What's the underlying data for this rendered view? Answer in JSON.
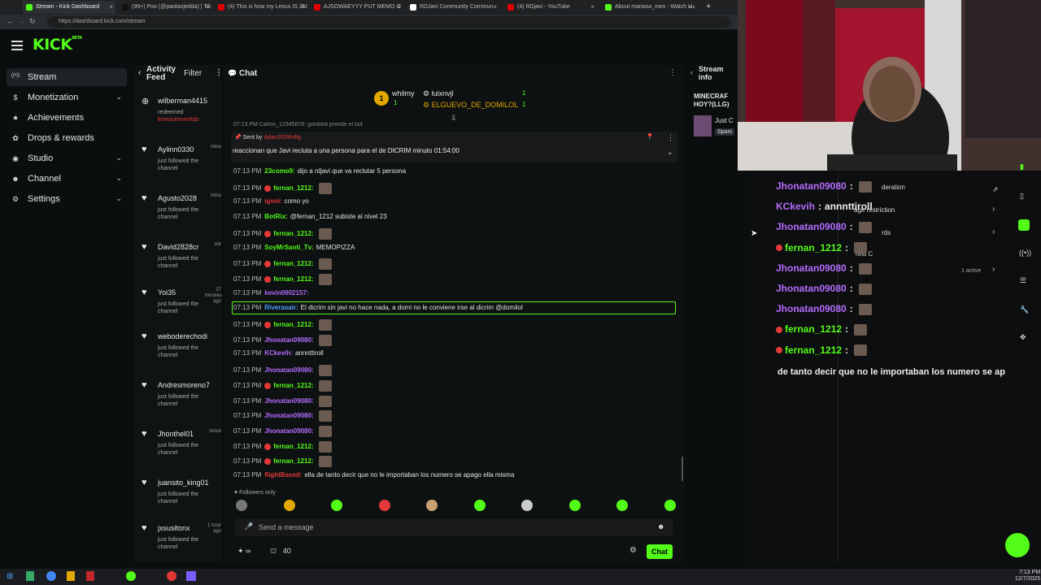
{
  "browser": {
    "tabs": [
      {
        "title": "Stream - Kick Dashboard",
        "color": "#53fc18",
        "active": true
      },
      {
        "title": "(99+) Poo (@paolaojedda) | TikTok",
        "color": "#111111",
        "active": false
      },
      {
        "title": "(4) This is how my Lexus IS 350 lo",
        "color": "#e00000",
        "active": false
      },
      {
        "title": "AJSOWAEYYY PUT MEMO O",
        "color": "#e00000",
        "active": false
      },
      {
        "title": "RDJavi Community Commun",
        "color": "#ffffff",
        "active": false
      },
      {
        "title": "(4) RDjavi - YouTube",
        "color": "#e00000",
        "active": false
      },
      {
        "title": "About mariasa_mex - Watch Live",
        "color": "#53fc18",
        "active": false
      }
    ],
    "url": "https://dashboard.kick.com/stream"
  },
  "brand": {
    "logo": "KICK",
    "logo_sup": "BETA",
    "accent": "#53fc18"
  },
  "sidebar": {
    "items": [
      {
        "label": "Stream",
        "icon": "broadcast-icon",
        "active": true,
        "expand": false
      },
      {
        "label": "Monetization",
        "icon": "dollar-icon",
        "active": false,
        "expand": true
      },
      {
        "label": "Achievements",
        "icon": "star-icon",
        "active": false,
        "expand": false
      },
      {
        "label": "Drops & rewards",
        "icon": "gift-icon",
        "active": false,
        "expand": false
      },
      {
        "label": "Studio",
        "icon": "studio-icon",
        "active": false,
        "expand": true
      },
      {
        "label": "Channel",
        "icon": "user-icon",
        "active": false,
        "expand": true
      },
      {
        "label": "Settings",
        "icon": "gear-icon",
        "active": false,
        "expand": true
      }
    ]
  },
  "feed": {
    "title_line1": "Activity",
    "title_line2": "Feed",
    "filter_label": "Filter",
    "items": [
      {
        "name": "wilberman4415",
        "ago": "",
        "action": "redeemed",
        "extra": "timeoutreverttdo",
        "icon": "redeem-icon"
      },
      {
        "name": "Aylinn0330",
        "ago": "minu",
        "action": "just followed the channel",
        "icon": "heart-icon"
      },
      {
        "name": "Agusto2028",
        "ago": "minu",
        "action": "just followed the channel",
        "icon": "heart-icon"
      },
      {
        "name": "David2828cr",
        "ago": "mir",
        "action": "just followed the channel",
        "icon": "heart-icon"
      },
      {
        "name": "Yoi35",
        "ago": "27 minutes ago",
        "action": "just followed the channel",
        "icon": "heart-icon"
      },
      {
        "name": "weboderechodi",
        "ago": "",
        "action": "just followed the channel",
        "icon": "heart-icon"
      },
      {
        "name": "Andresmoreno7",
        "ago": "",
        "action": "just followed the channel",
        "icon": "heart-icon"
      },
      {
        "name": "Jhonthel01",
        "ago": "minut",
        "action": "just followed the channel",
        "icon": "heart-icon"
      },
      {
        "name": "juansito_king01",
        "ago": "",
        "action": "just followed the channel",
        "icon": "heart-icon"
      },
      {
        "name": "jxsusitonx",
        "ago": "1 hour ago",
        "action": "just followed the channel",
        "icon": "heart-icon"
      }
    ]
  },
  "chat": {
    "title": "Chat",
    "leaders": [
      {
        "rank": "1",
        "name": "whilmy",
        "count": "1"
      },
      {
        "rank": "",
        "name": "luixnvjl",
        "count": "1"
      },
      {
        "rank": "",
        "name": "ELGUEVO_DE_DOMILOL",
        "count": "1"
      }
    ],
    "top_snippet": "07:13 PM  Carlos_12345678: gordolol prende el bot",
    "pinned_by_label": "Sent by",
    "pinned_by_user": "dylan2028hdtg",
    "pinned_text": "reaccionan que Javi reciuta a una persona para el de DICRIM minuto 01:54:00",
    "messages": [
      {
        "time": "07:13 PM",
        "user": "23como9:",
        "color": "#53fc18",
        "text": "dijo a rdjavi que va reclutar 5 persona",
        "emote": false,
        "badge": false
      },
      {
        "time": "07:13 PM",
        "user": "fernan_1212:",
        "color": "#53fc18",
        "text": "",
        "emote": true,
        "badge": true
      },
      {
        "time": "07:13 PM",
        "user": "igsni:",
        "color": "#e23838",
        "text": "como yo",
        "emote": false,
        "badge": false
      },
      {
        "time": "07:13 PM",
        "user": "BotRix:",
        "color": "#53fc18",
        "text": "@fernan_1212 subiste al nivel 23",
        "emote": false,
        "badge": false
      },
      {
        "time": "07:13 PM",
        "user": "fernan_1212:",
        "color": "#53fc18",
        "text": "",
        "emote": true,
        "badge": true
      },
      {
        "time": "07:13 PM",
        "user": "SoyMrSanti_Tv:",
        "color": "#53fc18",
        "text": "MEMOPIZZA",
        "emote": false,
        "badge": false
      },
      {
        "time": "07:13 PM",
        "user": "fernan_1212:",
        "color": "#53fc18",
        "text": "",
        "emote": true,
        "badge": true
      },
      {
        "time": "07:13 PM",
        "user": "fernan_1212:",
        "color": "#53fc18",
        "text": "",
        "emote": true,
        "badge": true
      },
      {
        "time": "07:13 PM",
        "user": "kevin0902157:",
        "color": "#b56cff",
        "text": "",
        "emote": false,
        "badge": false
      },
      {
        "time": "07:13 PM",
        "user": "Riverasair:",
        "color": "#4fa3ff",
        "text": "El dicrim sin javi no hace nada, a domi no le conviene irse al dicrim @domilol",
        "emote": false,
        "badge": false
      },
      {
        "time": "07:13 PM",
        "user": "fernan_1212:",
        "color": "#53fc18",
        "text": "",
        "emote": true,
        "badge": true
      },
      {
        "time": "07:13 PM",
        "user": "Jhonatan09080:",
        "color": "#b56cff",
        "text": "",
        "emote": true,
        "badge": false
      },
      {
        "time": "07:13 PM",
        "user": "KCkevih:",
        "color": "#b56cff",
        "text": "annnttiroll",
        "emote": false,
        "badge": false
      },
      {
        "time": "07:13 PM",
        "user": "Jhonatan09080:",
        "color": "#b56cff",
        "text": "",
        "emote": true,
        "badge": false
      },
      {
        "time": "07:13 PM",
        "user": "fernan_1212:",
        "color": "#53fc18",
        "text": "",
        "emote": true,
        "badge": true
      },
      {
        "time": "07:13 PM",
        "user": "Jhonatan09080:",
        "color": "#b56cff",
        "text": "",
        "emote": true,
        "badge": false
      },
      {
        "time": "07:13 PM",
        "user": "Jhonatan09080:",
        "color": "#b56cff",
        "text": "",
        "emote": true,
        "badge": false
      },
      {
        "time": "07:13 PM",
        "user": "Jhonatan09080:",
        "color": "#b56cff",
        "text": "",
        "emote": true,
        "badge": false
      },
      {
        "time": "07:13 PM",
        "user": "fernan_1212:",
        "color": "#53fc18",
        "text": "",
        "emote": true,
        "badge": true
      },
      {
        "time": "07:13 PM",
        "user": "fernan_1212:",
        "color": "#53fc18",
        "text": "",
        "emote": true,
        "badge": true
      },
      {
        "time": "07:13 PM",
        "user": "flightBased:",
        "color": "#e23838",
        "text": "ella de tanto decir que no le importaban los numero se apago ella misma",
        "emote": false,
        "badge": false
      }
    ],
    "followers_only": "Followers only",
    "placeholder": "Send a message",
    "viewer_count": "40",
    "chat_button": "Chat"
  },
  "stream_info": {
    "title": "Stream info",
    "stream_title": "MINECRAF HOY?(LLG)",
    "category": "Just C",
    "language": "Spani"
  },
  "overlay": {
    "lines": [
      {
        "user": "Jhonatan09080",
        "sep": ":",
        "text": "",
        "color": "#b56cff",
        "badge": false
      },
      {
        "user": "KCkevih",
        "sep": ":",
        "text": "annnttiroll",
        "color": "#b56cff",
        "badge": false
      },
      {
        "user": "Jhonatan09080",
        "sep": ":",
        "text": "",
        "color": "#b56cff",
        "badge": false
      },
      {
        "user": "fernan_1212",
        "sep": ":",
        "text": "",
        "color": "#53fc18",
        "badge": true
      },
      {
        "user": "Jhonatan09080",
        "sep": ":",
        "text": "",
        "color": "#b56cff",
        "badge": false
      },
      {
        "user": "Jhonatan09080",
        "sep": ":",
        "text": "",
        "color": "#b56cff",
        "badge": false
      },
      {
        "user": "Jhonatan09080",
        "sep": ":",
        "text": "",
        "color": "#b56cff",
        "badge": false
      },
      {
        "user": "fernan_1212",
        "sep": ":",
        "text": "",
        "color": "#53fc18",
        "badge": true
      },
      {
        "user": "fernan_1212",
        "sep": ":",
        "text": "",
        "color": "#53fc18",
        "badge": true
      }
    ],
    "tail": "de tanto decir que no le importaban los numero se ap",
    "behind": [
      "deration",
      "age restriction",
      "rds",
      "rest C",
      "1 active"
    ]
  },
  "taskbar": {
    "time": "7:13 PM",
    "date": "12/7/2025"
  }
}
